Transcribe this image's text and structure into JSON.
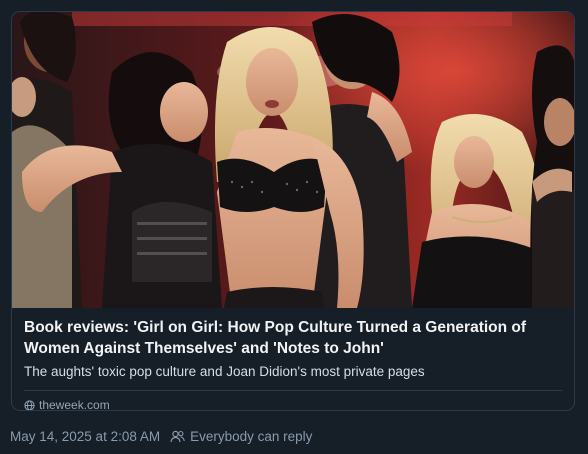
{
  "post": {
    "link_card": {
      "image_alt": "Performers on stage at a music awards show",
      "title": "Book reviews: 'Girl on Girl: How Pop Culture Turned a Generation of Women Against Themselves' and 'Notes to John'",
      "description": "The aughts' toxic pop culture and Joan Didion's most private pages",
      "domain": "theweek.com",
      "domain_icon": "globe-icon"
    },
    "meta": {
      "timestamp": "May 14, 2025 at 2:08 AM",
      "reply_icon": "people-icon",
      "reply_setting": "Everybody can reply"
    }
  },
  "colors": {
    "background": "#161e27",
    "card_border": "#2e3a47",
    "title_text": "#f1f3f5",
    "muted_text": "#8a9bad"
  }
}
